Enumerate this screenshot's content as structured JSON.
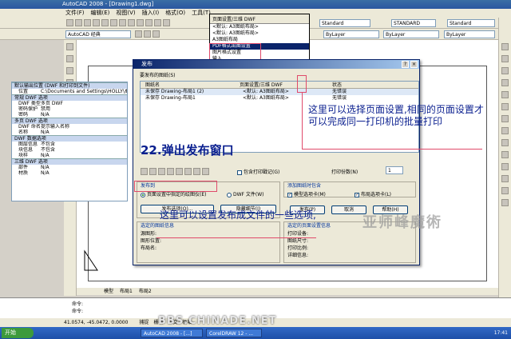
{
  "window": {
    "title": "AutoCAD 2008 - [Drawing1.dwg]",
    "menu": [
      "文件(F)",
      "编辑(E)",
      "视图(V)",
      "插入(I)",
      "格式(O)",
      "工具(T)"
    ],
    "workspace": "AutoCAD 经典",
    "layer_combo": "ByLayer",
    "linetype_combo": "ByLayer",
    "lineweight_combo": "ByLayer",
    "textstyle_combo": "Standard",
    "dimstyle_combo": "STANDARD",
    "tablestyle_combo": "Standard"
  },
  "page_setup_dropdown": {
    "header": "页面设置/三维 DWF",
    "items": [
      "<默认: A3图纸布局>",
      "<默认: A3图纸布局>",
      "A3图纸布局",
      "PDF格式出图设置",
      "图片格式设置",
      "输入..."
    ],
    "selected_index": 3
  },
  "publish_dialog": {
    "title": "发布",
    "list_label": "要发布的图纸(S)",
    "columns": [
      "图纸名",
      "页面设置/三维 DWF",
      "状态"
    ],
    "rows": [
      {
        "name": "未保存 Drawing-布局1 (2)",
        "setup": "<默认: A3图纸布局>",
        "status": "无错误"
      },
      {
        "name": "未保存 Drawing-布局1",
        "setup": "<默认: A3图纸布局>",
        "status": "无错误"
      }
    ],
    "include_stamp": "包含打印戳记(G)",
    "copies_label": "打印份数(N)",
    "copies": "1",
    "publish_to_label": "发布到",
    "publish_radio_plotter": "页面设置中指定的绘图仪(E)",
    "publish_radio_dwf": "DWF 文件(W)",
    "add_when_label": "添加图纸时包含",
    "model_tab": "模型选项卡(M)",
    "layout_tab": "布局选项卡(L)",
    "publish_options_btn": "发布选项(O)...",
    "hide_details_btn": "隐藏细节(I)",
    "publish_btn": "发布(P)",
    "cancel_btn": "取消",
    "help_btn": "帮助(H)",
    "selected_info_label": "选定的图纸信息",
    "info_source": "源图形:",
    "info_location": "图形位置:",
    "info_layout": "布局名:",
    "page_info_label": "选定的页面设置信息",
    "page_device": "打印设备:",
    "page_size": "图纸尺寸:",
    "page_scale": "打印比例:",
    "page_detail": "详细信息:"
  },
  "properties_panel": {
    "sections": [
      {
        "title": "默认输出位置 (DWF 和打印到文件)",
        "rows": [
          [
            "位置",
            "C:\\Documents and Settings\\HOLLY\\桌面\\"
          ]
        ]
      },
      {
        "title": "常规 DWF 选项",
        "rows": [
          [
            "DWF 类型",
            "多页 DWF"
          ],
          [
            "密码保护",
            "禁用"
          ],
          [
            "密码",
            "N/A"
          ]
        ]
      },
      {
        "title": "多页 DWF 选项",
        "rows": [
          [
            "DWF 命名",
            "提示输入名称"
          ],
          [
            "名称",
            "N/A"
          ]
        ]
      },
      {
        "title": "DWF 数据选项",
        "rows": [
          [
            "图层信息",
            "不包含"
          ],
          [
            "块信息",
            "不包含"
          ],
          [
            "块样",
            "N/A"
          ]
        ]
      },
      {
        "title": "三维 DWF 选项",
        "rows": [
          [
            "部件",
            "N/A"
          ],
          [
            "材质",
            "N/A"
          ]
        ]
      }
    ]
  },
  "annotations": {
    "top_right": "这里可以选择页面设置,相同的页面设置才可以完成同一打印机的批量打印",
    "step": "22.弹出发布窗口",
    "bottom": "这里可以设置发布成文件的一些选项,"
  },
  "tabs": [
    "模型",
    "布局1",
    "布局2"
  ],
  "command_lines": [
    "命令:",
    "命令:"
  ],
  "status": {
    "coords": "41.0574, -45.0472, 0.0000",
    "modes": [
      "捕捉",
      "栅格",
      "正交",
      "极轴"
    ]
  },
  "taskbar": {
    "start": "开始",
    "tasks": [
      "AutoCAD 2008 - [...]",
      "CorelDRAW 12 - ..."
    ],
    "time": "17:41"
  },
  "watermarks": {
    "signature": "亚师峰魔術",
    "site": "BBS.CHINADE.NET"
  }
}
